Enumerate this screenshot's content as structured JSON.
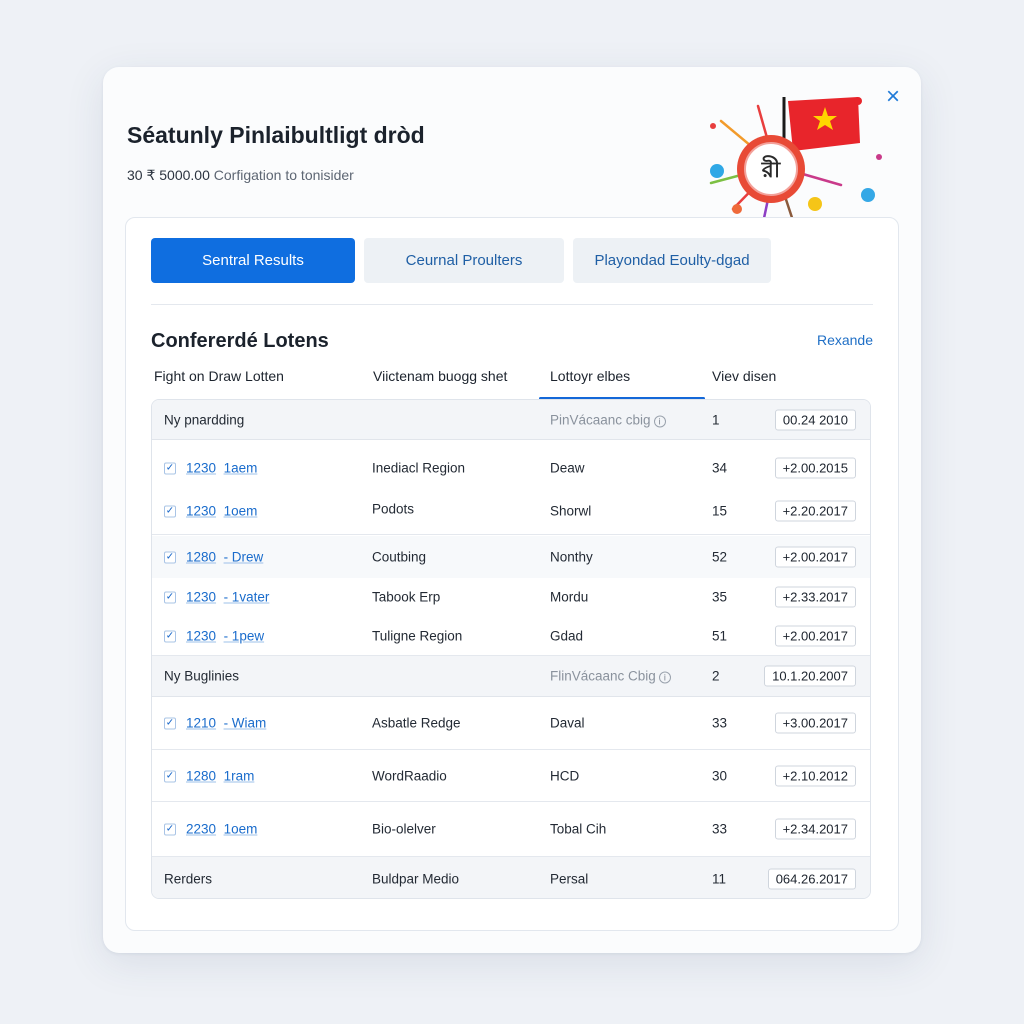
{
  "dialog": {
    "title": "Séatunly Pinlaibultligt dròd",
    "subtitle_amount": "30 ₹ 5000.00",
    "subtitle_text": "Corfigation to tonisider",
    "close_icon": "×",
    "badge_text": "রী"
  },
  "tabs": [
    {
      "label": "Sentral Results",
      "active": true
    },
    {
      "label": "Ceurnal Proulters",
      "active": false
    },
    {
      "label": "Playondad Eoulty-dgad",
      "active": false
    }
  ],
  "section": {
    "title": "Confererdé Lotens",
    "action_label": "Rexande"
  },
  "columns": [
    "Fight on Draw Lotten",
    "Viictenam buogg shet",
    "Lottoyr elbes",
    "Viev disen"
  ],
  "rows": [
    {
      "kind": "group",
      "name": "Ny pnardding",
      "status": "PinVácaanc cbig",
      "num": "1",
      "date": "00.24 2010"
    },
    {
      "kind": "item",
      "code": "1230",
      "link": "1aem",
      "region": "Inediacl Region",
      "type": "Deaw",
      "num": "34",
      "date": "+2.00.2015"
    },
    {
      "kind": "item",
      "code": "1230",
      "link": "1oem",
      "region": "Podots",
      "type": "Shorwl",
      "num": "15",
      "date": "+2.20.2017"
    },
    {
      "kind": "item",
      "code": "1280",
      "link": "- Drew",
      "region": "Coutbing",
      "type": "Nonthy",
      "num": "52",
      "date": "+2.00.2017"
    },
    {
      "kind": "item",
      "code": "1230",
      "link": "- 1vater",
      "region": "Tabook Erp",
      "type": "Mordu",
      "num": "35",
      "date": "+2.33.2017"
    },
    {
      "kind": "item",
      "code": "1230",
      "link": "- 1pew",
      "region": "Tuligne Region",
      "type": "Gdad",
      "num": "51",
      "date": "+2.00.2017"
    },
    {
      "kind": "group",
      "name": "Ny Buglinies",
      "status": "FlinVácaanc Cbig",
      "num": "2",
      "date": "10.1.20.2007"
    },
    {
      "kind": "item",
      "code": "1210",
      "link": "- Wiam",
      "region": "Asbatle Redge",
      "type": "Daval",
      "num": "33",
      "date": "+3.00.2017"
    },
    {
      "kind": "item",
      "code": "1280",
      "link": "1ram",
      "region": "WordRaadio",
      "type": "HCD",
      "num": "30",
      "date": "+2.10.2012"
    },
    {
      "kind": "item",
      "code": "2230",
      "link": "1oem",
      "region": "Bio-olelver",
      "type": "Tobal Cih",
      "num": "33",
      "date": "+2.34.2017"
    },
    {
      "kind": "group",
      "name": "Rerders",
      "region": "Buldpar Medio",
      "type": "Persal",
      "num": "11",
      "date": "064.26.2017"
    }
  ],
  "colors": {
    "accent": "#0f6ee0",
    "link": "#1a6ccc",
    "flag_red": "#e8252b",
    "flag_star": "#ffd600"
  },
  "icons": [
    "close-icon",
    "flag-icon",
    "lottery-ball-icon",
    "checkbox-checked-icon",
    "info-icon"
  ]
}
